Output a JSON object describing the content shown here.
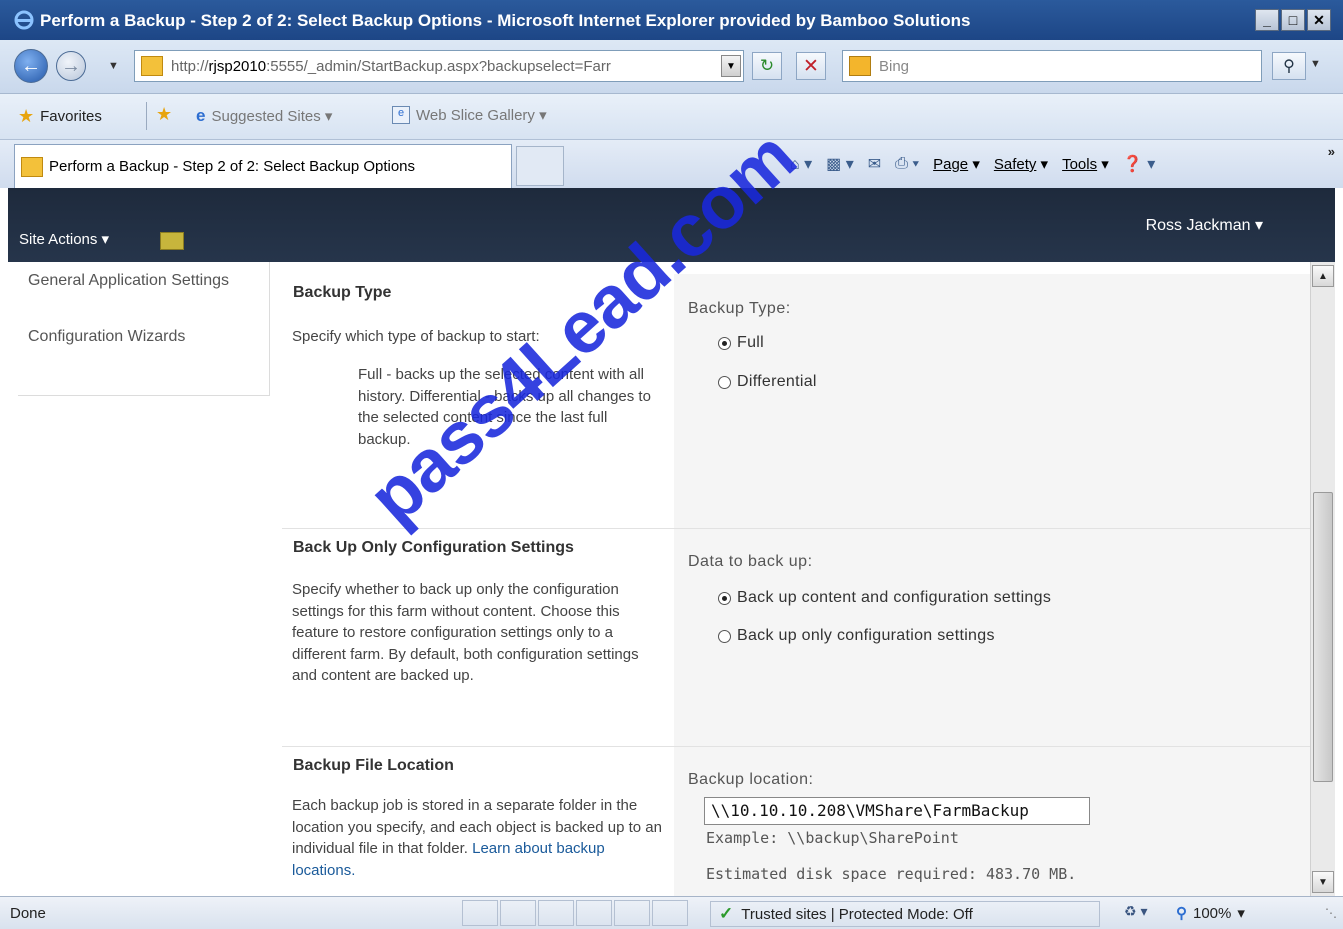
{
  "window": {
    "title": "Perform a Backup - Step 2 of 2: Select Backup Options - Microsoft Internet Explorer provided by Bamboo Solutions",
    "buttons": [
      "_",
      "□",
      "✕"
    ]
  },
  "address": {
    "url_prefix": "http://",
    "url_host": "rjsp2010",
    "url_rest": ":5555/_admin/StartBackup.aspx?backupselect=Farr",
    "search_placeholder": "Bing"
  },
  "favorites": {
    "label": "Favorites",
    "suggested": "Suggested Sites ▾",
    "webslice": "Web Slice Gallery ▾"
  },
  "tab": {
    "title": "Perform a Backup - Step 2 of 2: Select Backup Options"
  },
  "commandbar": {
    "page": "Page",
    "safety": "Safety",
    "tools": "Tools"
  },
  "sharepoint": {
    "site_actions": "Site Actions ▾",
    "user": "Ross Jackman ▾"
  },
  "leftnav": {
    "items": [
      {
        "label": "General Application Settings"
      },
      {
        "label": "Configuration Wizards"
      }
    ]
  },
  "sections": {
    "backup_type": {
      "title": "Backup Type",
      "intro": "Specify which type of backup to start:",
      "detail": "Full - backs up the selected content with all history. Differential - backs up all changes to the selected content since the last full backup.",
      "control_label": "Backup Type:",
      "options": [
        {
          "label": "Full",
          "selected": true
        },
        {
          "label": "Differential",
          "selected": false
        }
      ]
    },
    "config_only": {
      "title": "Back Up Only Configuration Settings",
      "description": "Specify whether to back up only the configuration settings for this farm without content. Choose this feature to restore configuration settings only to a different farm. By default, both configuration settings and content are backed up.",
      "control_label": "Data to back up:",
      "options": [
        {
          "label": "Back up content and configuration settings",
          "selected": true
        },
        {
          "label": "Back up only configuration settings",
          "selected": false
        }
      ]
    },
    "file_location": {
      "title": "Backup File Location",
      "description": "Each backup job is stored in a separate folder in the location you specify, and each object is backed up to an individual file in that folder.",
      "link": "Learn about backup locations.",
      "control_label": "Backup location:",
      "value": "\\\\10.10.10.208\\VMShare\\FarmBackup",
      "example": "Example: \\\\backup\\SharePoint",
      "estimate": "Estimated disk space required: 483.70 MB."
    }
  },
  "statusbar": {
    "status": "Done",
    "zone": "Trusted sites | Protected Mode: Off",
    "zoom": "100%"
  },
  "watermark": "pass4Lead.com",
  "colors": {
    "titlebar": "#1d4686",
    "sp_header": "#1e2a3c",
    "watermark": "#1928dc",
    "link": "#1a5a9a"
  }
}
